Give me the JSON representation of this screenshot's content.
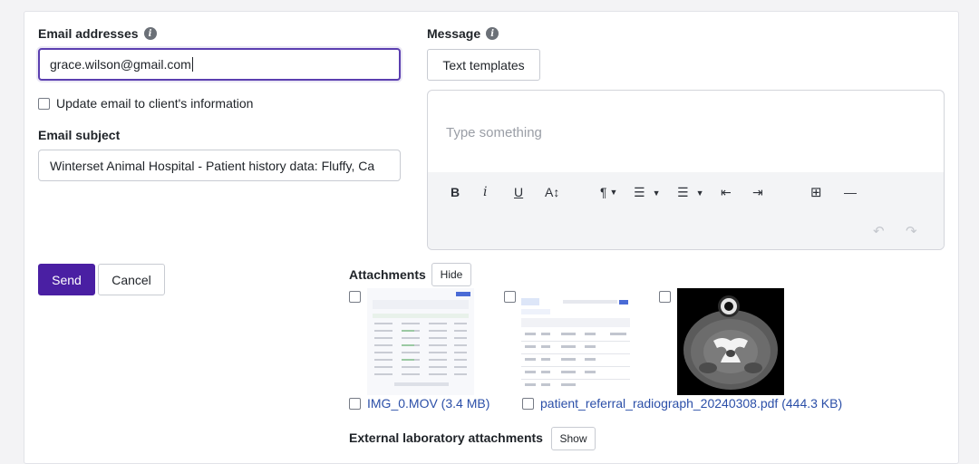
{
  "email": {
    "label": "Email addresses",
    "value": "grace.wilson@gmail.com",
    "update_checkbox_label": "Update email to client's information"
  },
  "subject": {
    "label": "Email subject",
    "value": "Winterset Animal Hospital - Patient history data: Fluffy, Ca"
  },
  "message": {
    "label": "Message",
    "templates_button": "Text templates",
    "placeholder": "Type something"
  },
  "actions": {
    "send": "Send",
    "cancel": "Cancel"
  },
  "attachments": {
    "label": "Attachments",
    "toggle": "Hide",
    "files": [
      {
        "name": "IMG_0.MOV (3.4 MB)"
      },
      {
        "name": "patient_referral_radiograph_20240308.pdf (444.3 KB)"
      }
    ]
  },
  "external": {
    "label": "External laboratory attachments",
    "toggle": "Show"
  },
  "toolbar": {
    "bold": "B",
    "italic": "i",
    "underline": "U",
    "font_size": "A↕",
    "paragraph": "¶",
    "ordered_list": "☰",
    "bullet_list": "☰",
    "outdent": "⇤",
    "indent": "⇥",
    "table": "⊞",
    "hr": "—",
    "undo": "↶",
    "redo": "↷"
  },
  "colors": {
    "primary": "#4a1fa3",
    "focus": "#5b3fb0",
    "link": "#2b4fa8"
  }
}
